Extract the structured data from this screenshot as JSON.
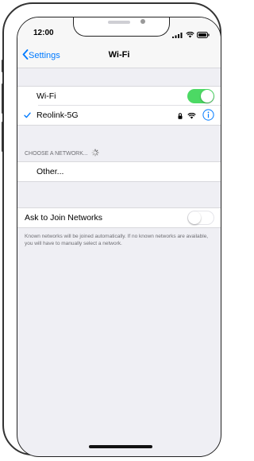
{
  "statusbar": {
    "time": "12:00"
  },
  "navbar": {
    "back_label": "Settings",
    "title": "Wi-Fi"
  },
  "wifi_group": {
    "wifi_label": "Wi-Fi",
    "wifi_enabled": true,
    "connected_network": "Reolink-5G",
    "connected_secured": true
  },
  "choose_section": {
    "header": "CHOOSE A NETWORK...",
    "other_label": "Other..."
  },
  "ask_group": {
    "label": "Ask to Join Networks",
    "enabled": false,
    "footnote": "Known networks will be joined automatically. If no known networks are available, you will have to manually select a network."
  },
  "colors": {
    "accent": "#007aff",
    "toggle_on": "#4cd964",
    "background": "#efeff4"
  }
}
